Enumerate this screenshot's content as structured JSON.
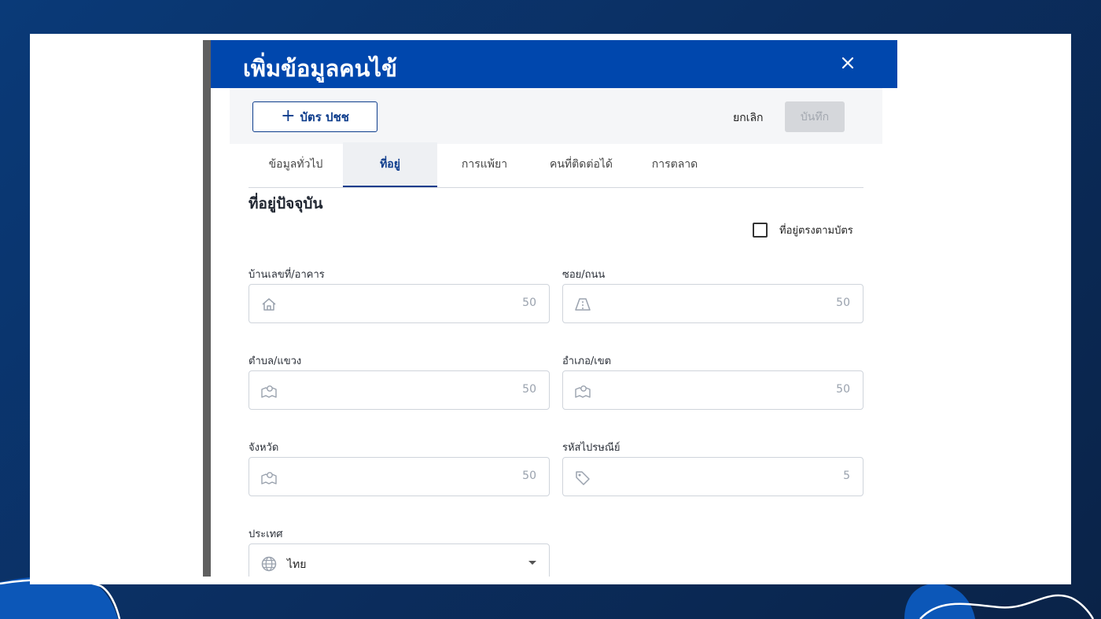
{
  "modal": {
    "title": "เพิ่มข้อมูลคนไข้",
    "id_card_button": "บัตร ปชช",
    "cancel_label": "ยกเลิก",
    "save_label": "บันทึก"
  },
  "tabs": [
    {
      "label": "ข้อมูลทั่วไป",
      "active": false
    },
    {
      "label": "ที่อยู่",
      "active": true
    },
    {
      "label": "การแพ้ยา",
      "active": false
    },
    {
      "label": "คนที่ติดต่อได้",
      "active": false
    },
    {
      "label": "การตลาด",
      "active": false
    }
  ],
  "address": {
    "section_title": "ที่อยู่ปัจจุบัน",
    "same_as_card_label": "ที่อยู่ตรงตามบัตร",
    "same_as_card_checked": false,
    "fields": {
      "house_no": {
        "label": "บ้านเลขที่/อาคาร",
        "value": "",
        "max": "50",
        "icon": "home-icon"
      },
      "soi_road": {
        "label": "ซอย/ถนน",
        "value": "",
        "max": "50",
        "icon": "road-icon"
      },
      "subdistrict": {
        "label": "ตำบล/แขวง",
        "value": "",
        "max": "50",
        "icon": "map-pin-icon"
      },
      "district": {
        "label": "อำเภอ/เขต",
        "value": "",
        "max": "50",
        "icon": "map-pin-icon"
      },
      "province": {
        "label": "จังหวัด",
        "value": "",
        "max": "50",
        "icon": "map-pin-icon"
      },
      "postcode": {
        "label": "รหัสไปรษณีย์",
        "value": "",
        "max": "5",
        "icon": "tag-icon"
      },
      "country": {
        "label": "ประเทศ",
        "value": "ไทย",
        "icon": "globe-icon"
      }
    }
  },
  "colors": {
    "header": "#0047ad",
    "primary": "#0d3c8c",
    "background": "#0b2f62"
  }
}
